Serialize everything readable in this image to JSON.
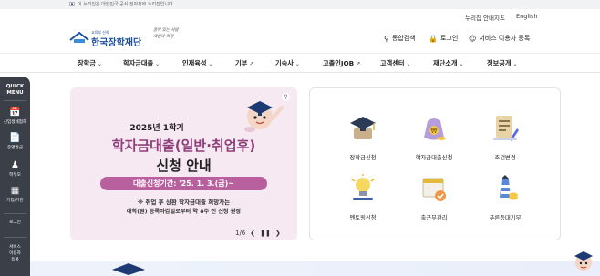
{
  "gov_bar": {
    "text": "이 누리집은 대한민국 공식 전자정부 누리집입니다."
  },
  "utility": {
    "sitemap": "누리집 안내지도",
    "english": "English"
  },
  "header": {
    "logo_small": "교육부 산하",
    "logo_name": "한국장학재단",
    "slogan_line1": "꿈이 있는 사람",
    "slogan_line2": "세상의 희망",
    "actions": [
      {
        "label": "통합검색",
        "icon": "search-icon"
      },
      {
        "label": "로그인",
        "icon": "lock-icon"
      },
      {
        "label": "서비스 이용자 등록",
        "icon": "user-add-icon"
      }
    ]
  },
  "gnb": [
    {
      "label": "장학금",
      "suffix": "chevron"
    },
    {
      "label": "학자금대출",
      "suffix": "chevron"
    },
    {
      "label": "인재육성",
      "suffix": "chevron"
    },
    {
      "label": "기부",
      "suffix": "external"
    },
    {
      "label": "기숙사",
      "suffix": "chevron"
    },
    {
      "label": "고졸인JOB",
      "suffix": "external"
    },
    {
      "label": "고객센터",
      "suffix": "chevron"
    },
    {
      "label": "재단소개",
      "suffix": "chevron"
    },
    {
      "label": "정보공개",
      "suffix": "chevron"
    }
  ],
  "quick_menu": {
    "title_line1": "QUICK",
    "title_line2": "MENU",
    "items": [
      {
        "label": "신입생체험해",
        "icon": "calendar-icon"
      },
      {
        "label": "증명발급",
        "icon": "document-icon"
      },
      {
        "label": "학부모",
        "icon": "family-icon"
      },
      {
        "label": "기업/기관",
        "icon": "building-icon"
      },
      {
        "label": "로그인",
        "icon": "lock-icon"
      },
      {
        "label_line1": "서비스",
        "label_line2": "이용자",
        "label_line3": "등록",
        "icon": "user-add-icon"
      }
    ]
  },
  "banner": {
    "year": "2025년 1학기",
    "headline1": "학자금대출(일반·취업후)",
    "headline2": "신청 안내",
    "period": "대출신청기간: '25. 1. 3.(금)~",
    "note_line1": "※ 취업 후 상환 학자금대출 희망자는",
    "note_line2": "대학(원) 등록마감일로부터 약 8주 전 신청 권장",
    "accent_color": "#8e3f7b",
    "pill_color": "#b85f9d"
  },
  "pager": {
    "current": "1",
    "total": "6",
    "display": "1/6"
  },
  "services": [
    {
      "label": "장학금신청",
      "icon": "graduation-cap-icon"
    },
    {
      "label": "학자금대출신청",
      "icon": "money-bag-icon"
    },
    {
      "label": "조건변경",
      "icon": "document-edit-icon"
    },
    {
      "label": "멘토링신청",
      "icon": "lightbulb-icon"
    },
    {
      "label": "출근부관리",
      "icon": "calendar-check-icon"
    },
    {
      "label": "푸른등대기부",
      "icon": "lighthouse-icon"
    }
  ]
}
